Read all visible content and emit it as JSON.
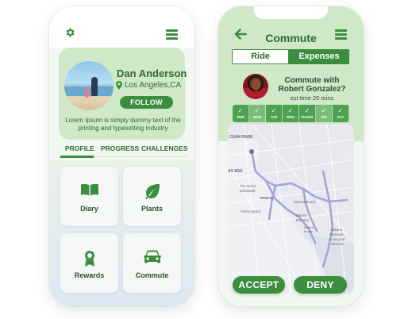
{
  "colors": {
    "brand_green": "#3b8e3e",
    "light_green": "#cfe8c8",
    "text_green": "#2f6b2f",
    "day_active": "#4ea152",
    "day_inactive": "#7cbd7b"
  },
  "profile_screen": {
    "settings_icon": "gear-icon",
    "menu_icon": "hamburger-menu-icon",
    "user": {
      "name": "Dan Anderson",
      "location": "Los Angeles,CA",
      "follow_label": "FOLLOW",
      "bio": "Lorem Ipsum is simply dummy text of the printing and typesetting industry"
    },
    "tabs": [
      {
        "label": "PROFILE",
        "active": true
      },
      {
        "label": "PROGRESS",
        "active": false
      },
      {
        "label": "CHALLENGES",
        "active": false
      }
    ],
    "tiles": [
      {
        "label": "Diary",
        "icon": "open-book-icon"
      },
      {
        "label": "Plants",
        "icon": "leaf-icon"
      },
      {
        "label": "Rewards",
        "icon": "award-ribbon-icon"
      },
      {
        "label": "Commute",
        "icon": "car-icon"
      }
    ]
  },
  "commute_screen": {
    "title": "Commute",
    "back_icon": "arrow-left-icon",
    "menu_icon": "hamburger-menu-icon",
    "segments": [
      {
        "label": "Ride",
        "active": false
      },
      {
        "label": "Expenses",
        "active": true
      }
    ],
    "prompt": {
      "line1": "Commute with",
      "line2": "Robert Gonzalez?",
      "est_time": "est time 20 mins"
    },
    "days": [
      {
        "label": "SUN",
        "checked": true,
        "highlight": false
      },
      {
        "label": "MON",
        "checked": true,
        "highlight": true
      },
      {
        "label": "TUE",
        "checked": true,
        "highlight": false
      },
      {
        "label": "WED",
        "checked": true,
        "highlight": false
      },
      {
        "label": "THURS",
        "checked": true,
        "highlight": false
      },
      {
        "label": "FRI",
        "checked": true,
        "highlight": true
      },
      {
        "label": "SAT",
        "checked": true,
        "highlight": false
      }
    ],
    "map": {
      "labels": [
        "CEAN PARK",
        "AX 8IN1",
        "The Venice",
        "Boardwalk",
        "VENICE",
        "Venice Beach",
        "Marina Beach",
        "Marina",
        "Del Rey",
        "Marina",
        "Beach",
        "Ballona",
        "Wetlands",
        "Ecological",
        "Reserve"
      ]
    },
    "accept_label": "ACCEPT",
    "deny_label": "DENY"
  }
}
